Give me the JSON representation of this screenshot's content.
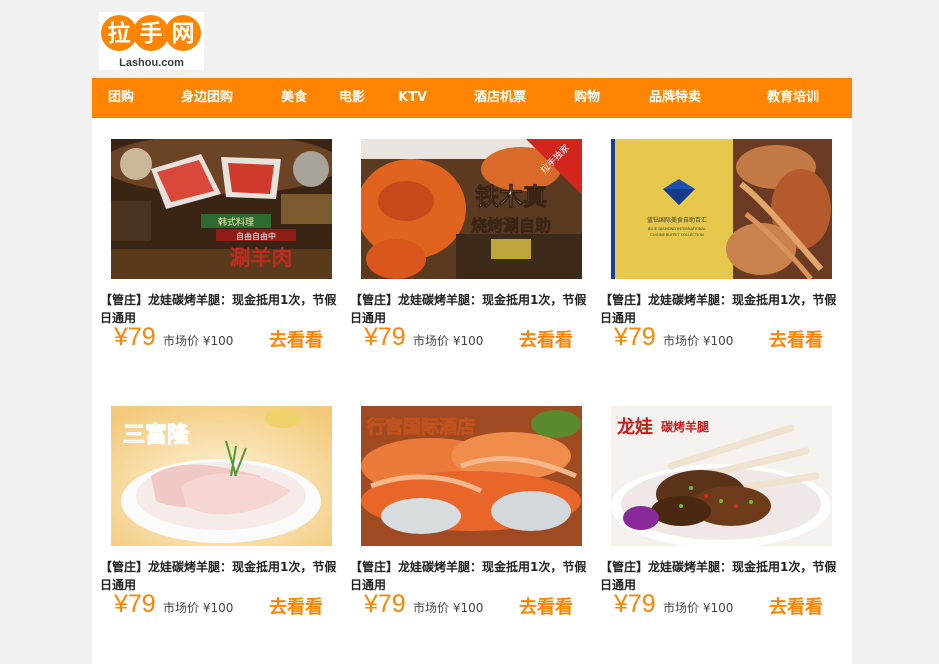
{
  "brand": {
    "logo_text": "拉手网",
    "logo_subtext": "Lashou.com",
    "color": "#ff8401"
  },
  "nav": {
    "items": [
      "团购",
      "身边团购",
      "美食",
      "电影",
      "KTV",
      "酒店机票",
      "购物",
      "品牌特卖",
      "教育培训"
    ]
  },
  "deals": [
    {
      "image": "hotpot-banner",
      "image_text": [
        "韩式料理",
        "自由自由中",
        "涮羊肉"
      ],
      "title": "【管庄】龙娃碳烤羊腿：现金抵用1次，节假日通用",
      "price": "¥79",
      "market": "市场价 ¥100",
      "cta": "去看看"
    },
    {
      "image": "crab-banner",
      "image_text": [
        "铁木真",
        "烧烤涮自助",
        "拉手独家"
      ],
      "title": "【管庄】龙娃碳烤羊腿：现金抵用1次，节假日通用",
      "price": "¥79",
      "market": "市场价 ¥100",
      "cta": "去看看"
    },
    {
      "image": "blue-diamond-banner",
      "image_text": [
        "蓝钻国际美食自助百汇",
        "BLUE DIAMOND INTERNATIONAL",
        "CUISINE BUFFET COLLECTION"
      ],
      "title": "【管庄】龙娃碳烤羊腿：现金抵用1次，节假日通用",
      "price": "¥79",
      "market": "市场价 ¥100",
      "cta": "去看看"
    },
    {
      "image": "sanfulong-banner",
      "image_text": [
        "三富隆"
      ],
      "title": "【管庄】龙娃碳烤羊腿：现金抵用1次，节假日通用",
      "price": "¥79",
      "market": "市场价 ¥100",
      "cta": "去看看"
    },
    {
      "image": "xinggong-banner",
      "image_text": [
        "行宫国际酒店"
      ],
      "title": "【管庄】龙娃碳烤羊腿：现金抵用1次，节假日通用",
      "price": "¥79",
      "market": "市场价 ¥100",
      "cta": "去看看"
    },
    {
      "image": "longwa-banner",
      "image_text": [
        "龙娃",
        "碳烤羊腿"
      ],
      "title": "【管庄】龙娃碳烤羊腿：现金抵用1次，节假日通用",
      "price": "¥79",
      "market": "市场价 ¥100",
      "cta": "去看看"
    }
  ]
}
